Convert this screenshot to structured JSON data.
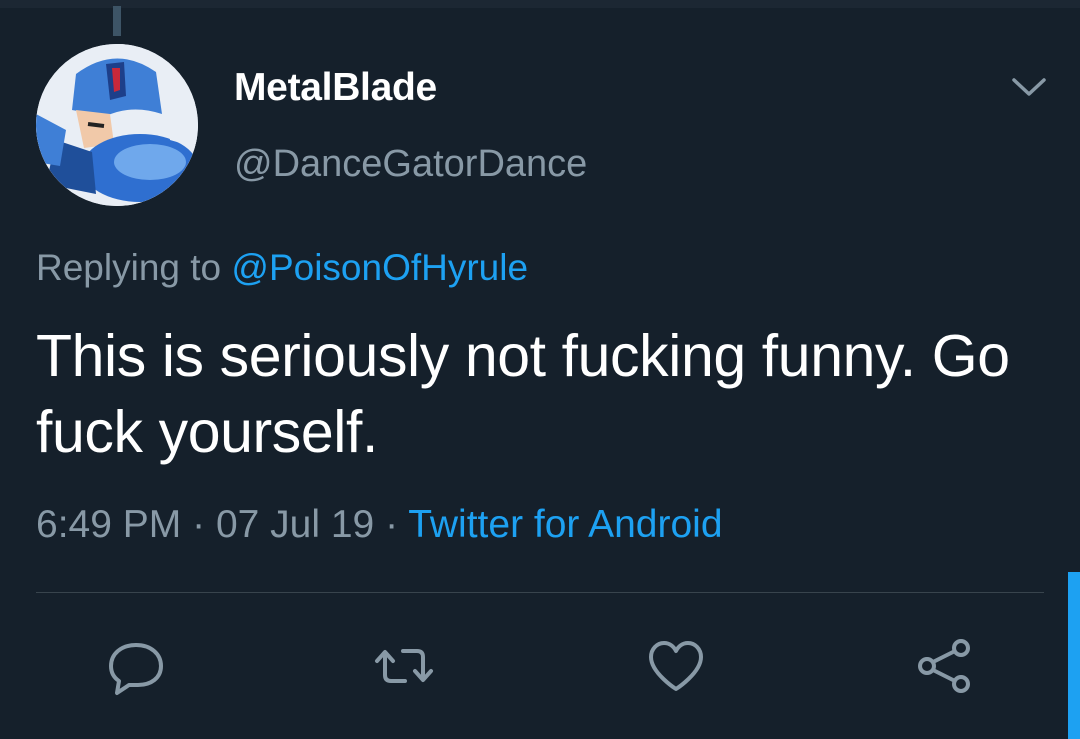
{
  "tweet": {
    "author": {
      "display_name": "MetalBlade",
      "handle": "@DanceGatorDance"
    },
    "reply_context": {
      "prefix": "Replying to",
      "mention": "@PoisonOfHyrule"
    },
    "text": "This is seriously not fucking funny. Go fuck yourself.",
    "time": "6:49 PM",
    "separator": "·",
    "date": "07 Jul 19",
    "source": "Twitter for Android"
  },
  "actions": {
    "reply_icon": "reply-icon",
    "retweet_icon": "retweet-icon",
    "like_icon": "heart-icon",
    "share_icon": "share-icon"
  },
  "colors": {
    "background": "#15202b",
    "accent": "#1da1f2",
    "secondary_text": "#8899a6",
    "primary_text": "#ffffff"
  }
}
